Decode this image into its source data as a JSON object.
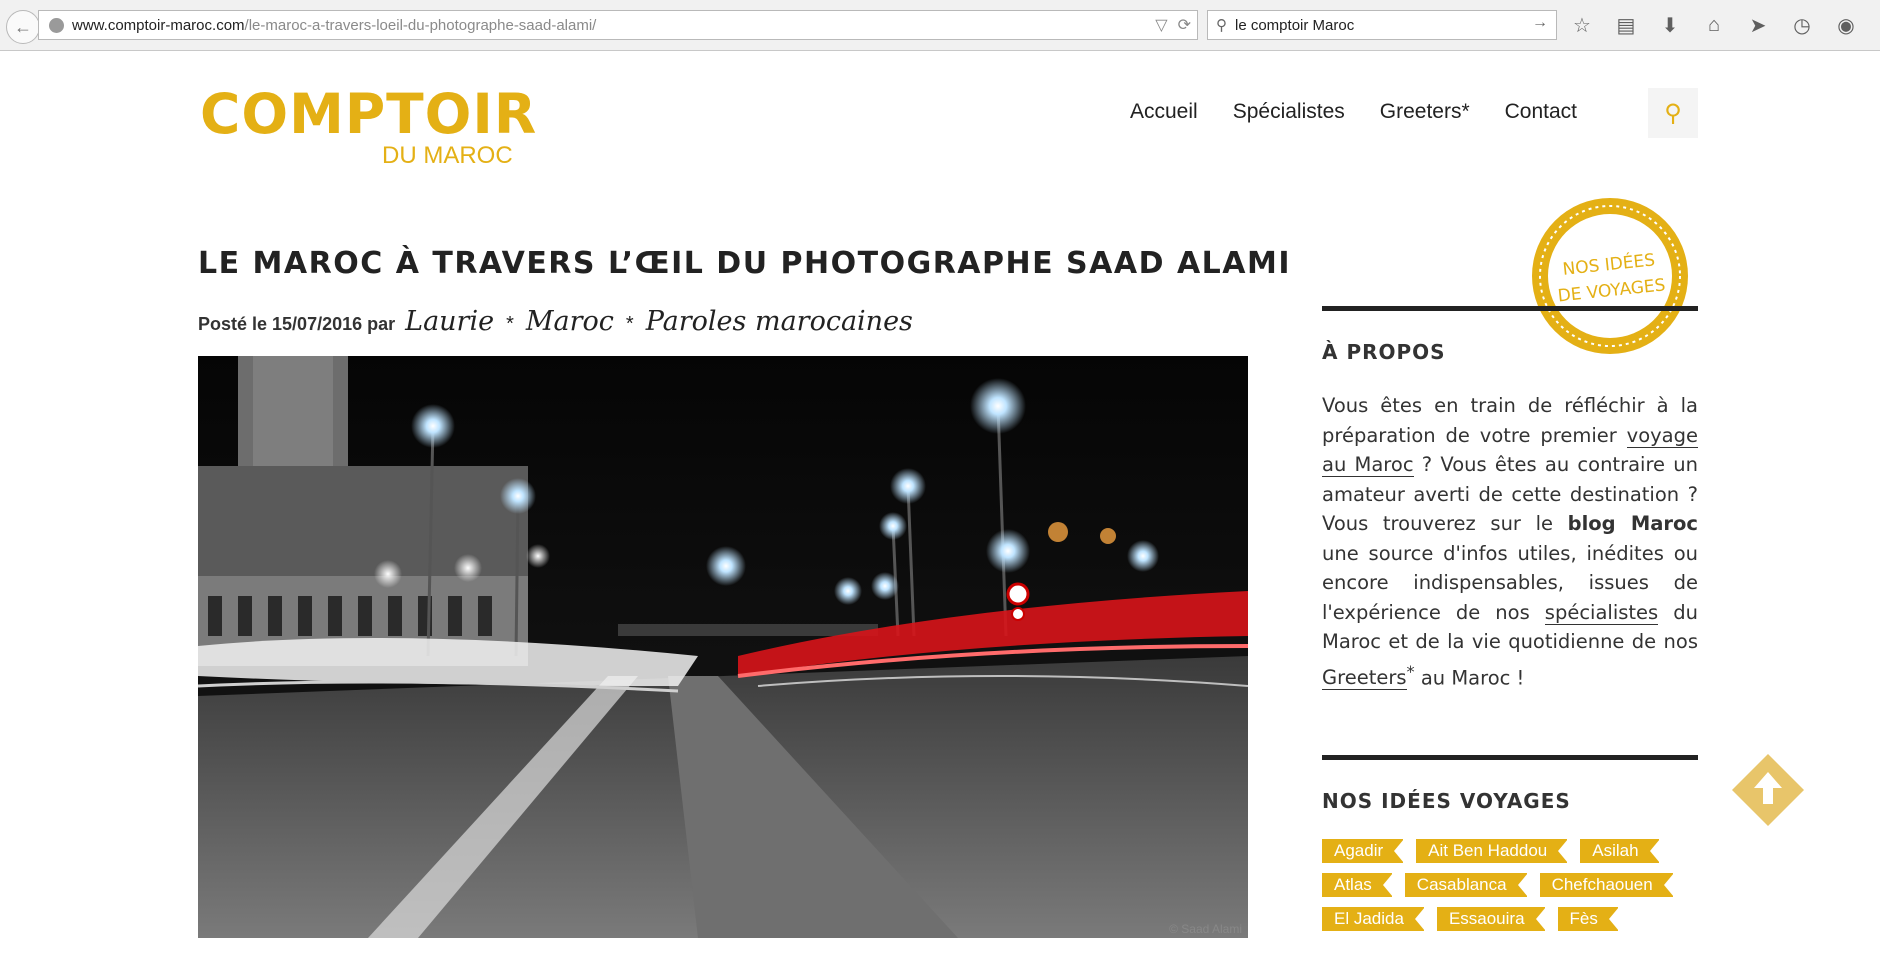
{
  "browser": {
    "url_host": "www.comptoir-maroc.com",
    "url_path": "/le-maroc-a-travers-loeil-du-photographe-saad-alami/",
    "search_query": "le comptoir Maroc"
  },
  "site": {
    "logo_main": "COMPTOIR",
    "logo_sub": "DU MAROC",
    "nav": [
      "Accueil",
      "Spécialistes",
      "Greeters*",
      "Contact"
    ],
    "accent_color": "#e4b015"
  },
  "post": {
    "title": "LE MAROC À TRAVERS L’ŒIL DU PHOTOGRAPHE SAAD ALAMI",
    "meta_prefix": "Posté le 15/07/2016 par",
    "author": "Laurie",
    "category1": "Maroc",
    "category2": "Paroles marocaines",
    "separator": "*",
    "photo_credit": "© Saad Alami"
  },
  "sidebar": {
    "badge_line1": "NOS IDÉES",
    "badge_line2": "DE VOYAGES",
    "about_heading": "À PROPOS",
    "about": {
      "t1": "Vous êtes en train de réfléchir à la préparation de votre premier ",
      "link1": "voyage au Maroc",
      "t2": " ? Vous êtes au contraire un amateur averti de cette destination ? Vous trouverez sur le ",
      "bold1": "blog Maroc",
      "t3": " une source d'infos utiles, inédites ou encore indispensables, issues de l'expérience de nos ",
      "link2": "spécialistes",
      "t4": " du Maroc et de la vie quotidienne de nos ",
      "link3": "Greeters",
      "sup": "*",
      "t5": " au Maroc !"
    },
    "ideas_heading": "NOS IDÉES VOYAGES",
    "tag_rows": [
      [
        "Agadir",
        "Ait Ben Haddou",
        "Asilah"
      ],
      [
        "Atlas",
        "Casablanca",
        "Chefchaouen"
      ],
      [
        "El Jadida",
        "Essaouira",
        "Fès"
      ]
    ]
  }
}
